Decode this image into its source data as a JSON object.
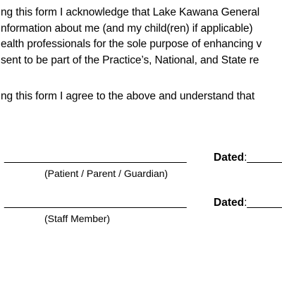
{
  "paragraph1": {
    "lines": [
      "ng this form I acknowledge that Lake Kawana General",
      "nformation about me (and my child(ren) if applicable)",
      "ealth professionals for the sole purpose of enhancing v",
      "sent to be part of the Practice’s, National, and State re"
    ]
  },
  "paragraph2": {
    "lines": [
      "ng this form I agree to the above and understand that"
    ]
  },
  "signature1": {
    "line": "______________________________",
    "caption": "(Patient / Parent / Guardian)",
    "dated_label": "Dated",
    "dated_colon_line": ":______"
  },
  "signature2": {
    "line": "______________________________",
    "caption": "(Staff Member)",
    "dated_label": "Dated",
    "dated_colon_line": ":______"
  }
}
